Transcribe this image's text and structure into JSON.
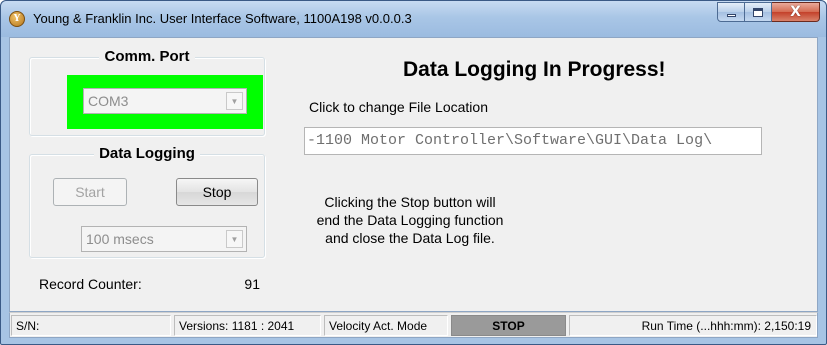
{
  "window": {
    "title": "Young & Franklin Inc. User Interface Software, 1100A198 v0.0.0.3",
    "icon_letter": "Y",
    "buttons": [
      "minimize-icon",
      "maximize-icon",
      "close-icon"
    ],
    "close_glyph": "X"
  },
  "comm_port": {
    "title": "Comm. Port",
    "selected": "COM3",
    "highlight_color": "#00ff00"
  },
  "data_logging": {
    "title": "Data Logging",
    "start_label": "Start",
    "stop_label": "Stop",
    "interval_selected": "100 msecs"
  },
  "record_counter": {
    "label": "Record Counter:",
    "value": "91"
  },
  "main": {
    "heading": "Data Logging In Progress!",
    "file_location_prompt": "Click to change File Location",
    "file_path": "-1100 Motor Controller\\Software\\GUI\\Data Log\\",
    "info_text": [
      "Clicking the Stop button will",
      "end the Data Logging function",
      "and close the Data Log file."
    ]
  },
  "status": {
    "serial": "S/N:",
    "versions": "Versions: 1181 : 2041",
    "mode": "Velocity Act. Mode",
    "state": "STOP",
    "run_time": "Run Time (...hhh:mm): 2,150:19"
  }
}
